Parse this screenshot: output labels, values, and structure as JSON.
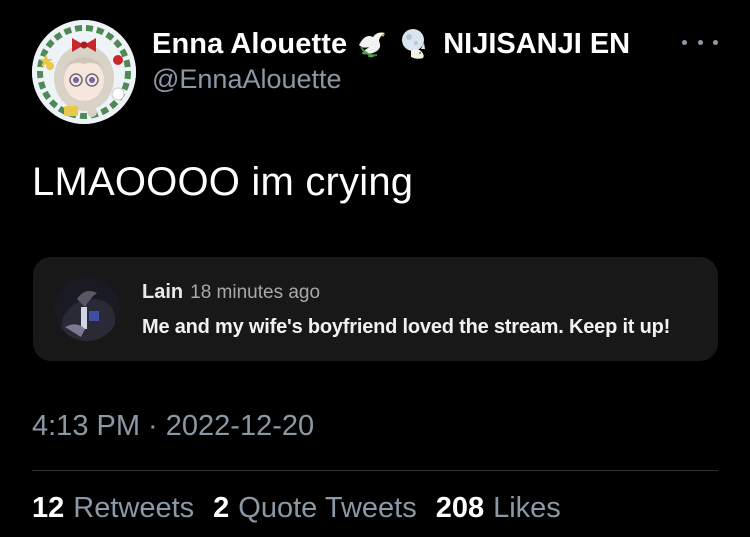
{
  "author": {
    "display_name": "Enna Alouette",
    "handle": "@EnnaAlouette",
    "name_emojis": [
      "dove-emoji-icon",
      "moon-rabbit-emoji-icon"
    ],
    "affiliation": "NIJISANJI EN",
    "avatar_icon": "profile-avatar"
  },
  "menu": {
    "more_icon": "more-options-icon"
  },
  "tweet": {
    "text": "LMAOOOO im crying"
  },
  "quoted_comment": {
    "author": "Lain",
    "time": "18 minutes ago",
    "body": "Me and my wife's boyfriend loved the stream. Keep it up!",
    "avatar_icon": "commenter-avatar"
  },
  "timestamp": "4:13 PM · 2022-12-20",
  "stats": {
    "retweets": {
      "count": "12",
      "label": "Retweets"
    },
    "quotes": {
      "count": "2",
      "label": "Quote Tweets"
    },
    "likes": {
      "count": "208",
      "label": "Likes"
    }
  },
  "colors": {
    "background": "#000000",
    "primary_text": "#ffffff",
    "secondary_text": "#8b98a5",
    "card_background": "#181818",
    "divider": "#2f3336"
  }
}
